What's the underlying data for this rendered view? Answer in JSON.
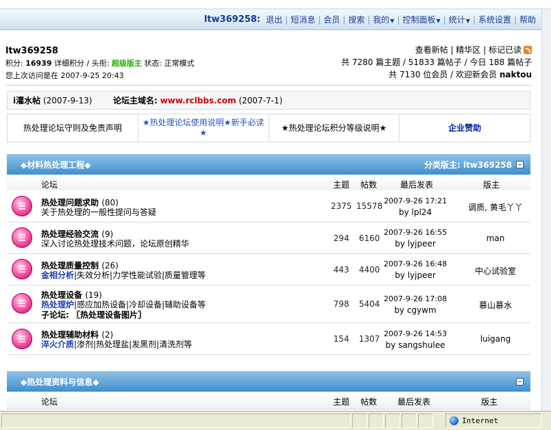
{
  "navbar": {
    "username": "ltw369258:",
    "items": [
      {
        "label": "退出",
        "dropdown": false
      },
      {
        "label": "短消息",
        "dropdown": false
      },
      {
        "label": "会员",
        "dropdown": false
      },
      {
        "label": "搜索",
        "dropdown": false
      },
      {
        "label": "我的",
        "dropdown": true
      },
      {
        "label": "控制面板",
        "dropdown": true
      },
      {
        "label": "统计",
        "dropdown": true
      },
      {
        "label": "系统设置",
        "dropdown": false
      },
      {
        "label": "帮助",
        "dropdown": false
      }
    ]
  },
  "user": {
    "name": "ltw369258",
    "points_label": "积分:",
    "points_value": "16939",
    "points_detail": "详细积分",
    "title_label": "头衔:",
    "title_value": "超级版主",
    "status_label": "状态:",
    "status_value": "正常模式",
    "last_visit_label": "您上次访问是在",
    "last_visit_value": "2007-9-25 20:43"
  },
  "stats": {
    "links": [
      "查看新帖",
      "精华区",
      "标记已读"
    ],
    "line2": "共 7280 篇主题 / 51833 篇帖子 / 今日 188 篇帖子",
    "line3_prefix": "共 7130 位会员 / 欢迎新会员",
    "newest_member": "naktou"
  },
  "announcement": {
    "title": "i灌水帖",
    "date": "(2007-9-13)",
    "domain_label": "论坛主域名:",
    "domain": "www.rclbbs.com",
    "domain_date": "(2007-7-1)"
  },
  "linkbar": [
    "热处理论坛守则及免责声明",
    "★热处理论坛使用说明★新手必读★",
    "★热处理论坛积分等级说明★",
    "企业赞助"
  ],
  "columns": {
    "forum": "论坛",
    "topics": "主题",
    "posts": "帖数",
    "last_post": "最后发表",
    "moderator": "版主"
  },
  "categories": [
    {
      "title": "◆材料热处理工程◆",
      "moderator_label": "分类版主: ltw369258",
      "forums": [
        {
          "name": "热处理问题求助",
          "count": "(80)",
          "sub_prefix": "",
          "desc": "关于热处理的一般性提问与答疑",
          "extra": "",
          "topics": "2375",
          "posts": "15578",
          "last_time": "2007-9-26 17:21",
          "last_by": "by lpl24",
          "moderator": "调质, 黄毛丫丫"
        },
        {
          "name": "热处理经验交流",
          "count": "(9)",
          "sub_prefix": "",
          "desc": "深入讨论热处理技术问题，论坛原创精华",
          "extra": "",
          "topics": "294",
          "posts": "6160",
          "last_time": "2007-9-26 16:55",
          "last_by": "by lyjpeer",
          "moderator": "man"
        },
        {
          "name": "热处理质量控制",
          "count": "(26)",
          "sub_prefix": "金相分析",
          "desc": "|失效分析|力学性能试验|质量管理等",
          "extra": "",
          "topics": "443",
          "posts": "4400",
          "last_time": "2007-9-26 16:48",
          "last_by": "by lyjpeer",
          "moderator": "中心试验室"
        },
        {
          "name": "热处理设备",
          "count": "(19)",
          "sub_prefix": "热处理炉",
          "desc": "|感应加热设备|冷却设备|辅助设备等",
          "extra": "子论坛: 〖热处理设备图片〗",
          "topics": "798",
          "posts": "5404",
          "last_time": "2007-9-26 17:08",
          "last_by": "by cgywm",
          "moderator": "慕山慕水"
        },
        {
          "name": "热处理辅助材料",
          "count": "(2)",
          "sub_prefix": "淬火介质",
          "desc": "|渗剂|热处理盐|发黑剂|清洗剂等",
          "extra": "",
          "topics": "154",
          "posts": "1307",
          "last_time": "2007-9-26 14:53",
          "last_by": "by sangshulee",
          "moderator": "luigang"
        }
      ]
    },
    {
      "title": "◆热处理资料与信息◆",
      "moderator_label": "",
      "forums": []
    }
  ],
  "statusbar": {
    "zone": "Internet"
  },
  "colors": {
    "nav_text": "#1a3f8f",
    "category_header": "#3f8fcc",
    "title_green": "#22b000",
    "domain_red": "#d40000"
  }
}
